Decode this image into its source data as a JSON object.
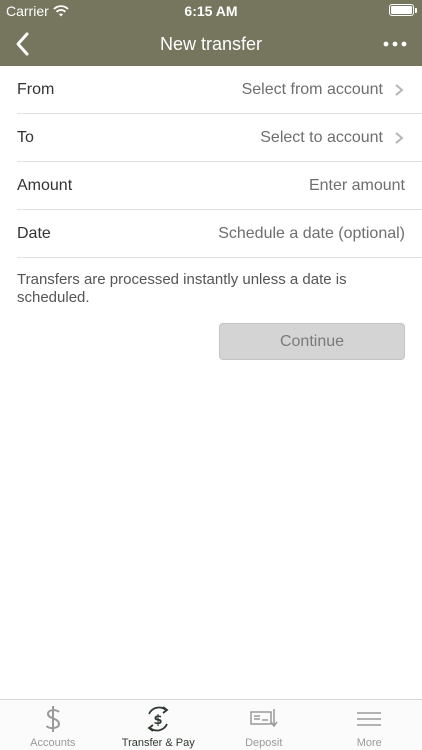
{
  "status_bar": {
    "carrier": "Carrier",
    "time": "6:15 AM"
  },
  "nav": {
    "title": "New transfer",
    "back_icon": "chevron-left-icon",
    "more_icon": "ellipsis-icon"
  },
  "form": {
    "from": {
      "label": "From",
      "value": "Select from account"
    },
    "to": {
      "label": "To",
      "value": "Select to account"
    },
    "amount": {
      "label": "Amount",
      "placeholder": "Enter amount"
    },
    "date": {
      "label": "Date",
      "placeholder": "Schedule a date (optional)"
    }
  },
  "note": "Transfers are processed instantly unless a date is scheduled.",
  "continue_label": "Continue",
  "tabs": [
    {
      "label": "Accounts",
      "icon": "dollar-icon",
      "active": false
    },
    {
      "label": "Transfer & Pay",
      "icon": "transfer-pay-icon",
      "active": true
    },
    {
      "label": "Deposit",
      "icon": "check-deposit-icon",
      "active": false
    },
    {
      "label": "More",
      "icon": "menu-icon",
      "active": false
    }
  ],
  "colors": {
    "header": "#75765d",
    "active_tab": "#2f3a31",
    "inactive_tab": "#9a9a9a",
    "button_disabled": "#d4d4d4"
  }
}
